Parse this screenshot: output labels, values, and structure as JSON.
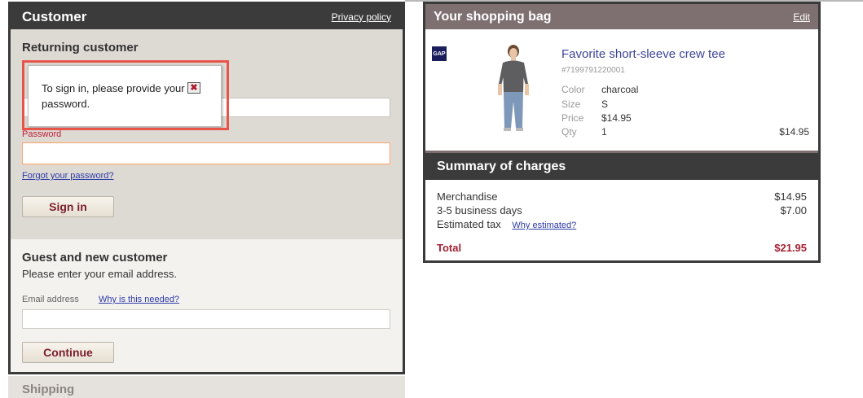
{
  "customer": {
    "title": "Customer",
    "privacy_link": "Privacy policy",
    "returning": {
      "title": "Returning customer",
      "password_label": "Password",
      "forgot_link": "Forgot your password?",
      "signin_label": "Sign in"
    },
    "guest": {
      "title": "Guest and new customer",
      "subtitle": "Please enter your email address.",
      "email_label": "Email address",
      "why_link": "Why is this needed?",
      "continue_label": "Continue"
    },
    "shipping_title": "Shipping"
  },
  "tooltip": {
    "message": "To sign in, please provide your password.",
    "close_glyph": "✖"
  },
  "bag": {
    "title": "Your shopping bag",
    "edit_link": "Edit",
    "item": {
      "brand": "GAP",
      "name": "Favorite short-sleeve crew tee",
      "sku": "#7199791220001",
      "color_label": "Color",
      "color_value": "charcoal",
      "size_label": "Size",
      "size_value": "S",
      "price_label": "Price",
      "price_value": "$14.95",
      "qty_label": "Qty",
      "qty_value": "1",
      "line_total": "$14.95"
    }
  },
  "summary": {
    "title": "Summary of charges",
    "merchandise_label": "Merchandise",
    "merchandise_value": "$14.95",
    "shipping_label": "3-5 business days",
    "shipping_value": "$7.00",
    "tax_label": "Estimated tax",
    "tax_link": "Why estimated?",
    "total_label": "Total",
    "total_value": "$21.95"
  },
  "colors": {
    "accent": "#a42134",
    "link": "#2d3aa8",
    "highlight": "#e8544a"
  }
}
